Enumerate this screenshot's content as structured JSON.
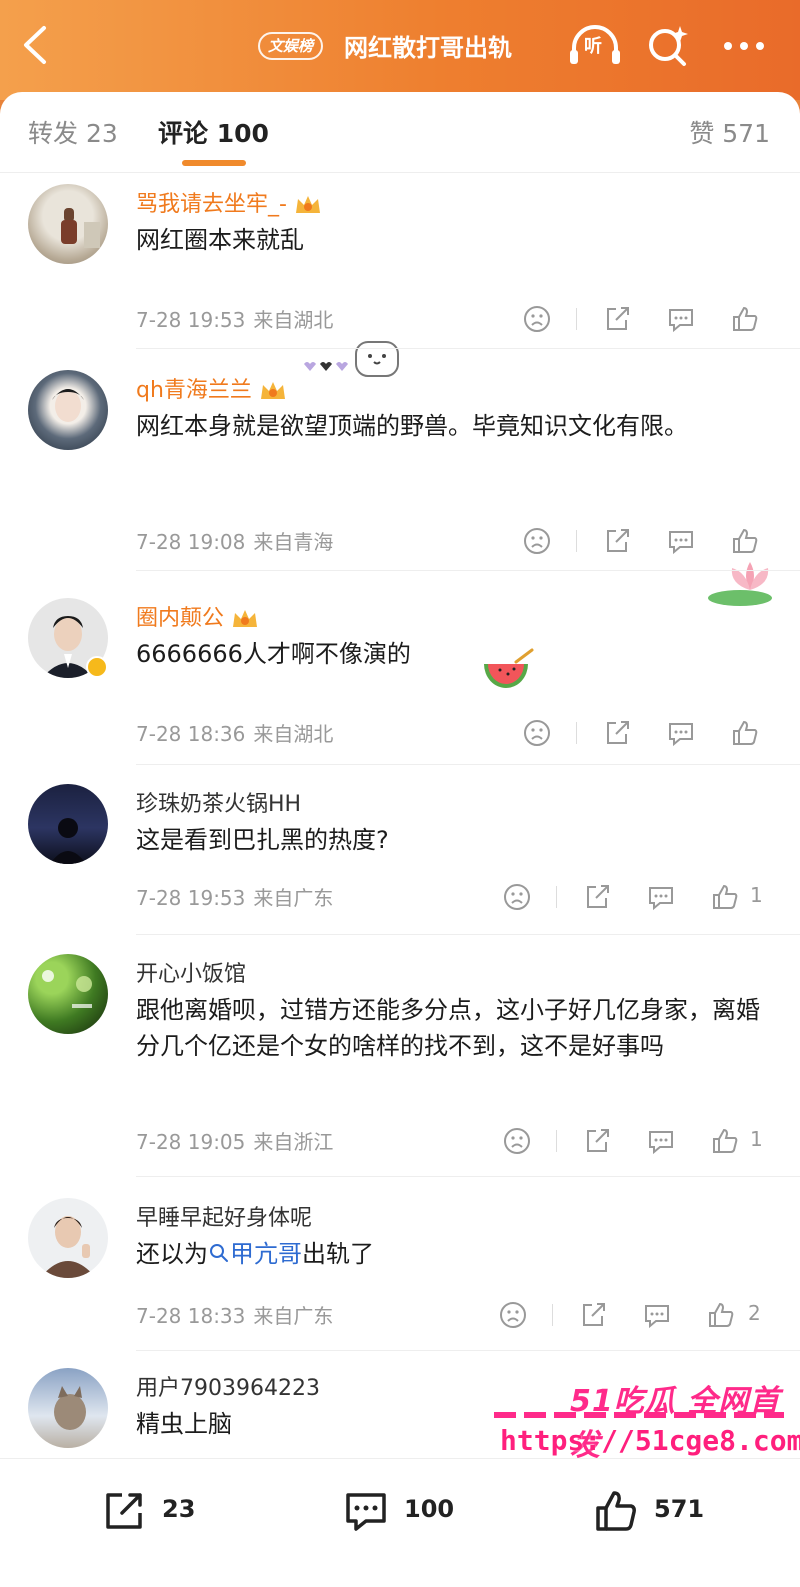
{
  "header": {
    "tag": "文娱榜",
    "title": "网红散打哥出轨",
    "listen_label": "听"
  },
  "tabs": {
    "repost_label": "转发",
    "repost_count": "23",
    "comments_label": "评论",
    "comments_count": "100",
    "likes_label": "赞",
    "likes_count": "571"
  },
  "comments": [
    {
      "username": "骂我请去坐牢_-",
      "text": "网红圈本来就乱",
      "date": "7-28 19:53",
      "region": "来自湖北",
      "likes": ""
    },
    {
      "username": "qh青海兰兰",
      "text": "网红本身就是欲望顶端的野兽。毕竟知识文化有限。",
      "date": "7-28 19:08",
      "region": "来自青海",
      "likes": ""
    },
    {
      "username": "圈内颠公",
      "text": "6666666人才啊不像演的",
      "date": "7-28 18:36",
      "region": "来自湖北",
      "likes": ""
    },
    {
      "username": "珍珠奶茶火锅HH",
      "text": "这是看到巴扎黑的热度?",
      "date": "7-28 19:53",
      "region": "来自广东",
      "likes": "1"
    },
    {
      "username": "开心小饭馆",
      "text": "跟他离婚呗，过错方还能多分点，这小子好几亿身家，离婚分几个亿还是个女的啥样的找不到，这不是好事吗",
      "date": "7-28 19:05",
      "region": "来自浙江",
      "likes": "1"
    },
    {
      "username": "早睡早起好身体呢",
      "text_before": "还以为",
      "topic": "甲亢哥",
      "text_after": "出轨了",
      "date": "7-28 18:33",
      "region": "来自广东",
      "likes": "2"
    },
    {
      "username": "用户7903964223",
      "text": "精虫上脑"
    }
  ],
  "watermark": {
    "brand": "51吃瓜 全网首发",
    "url": "https://51cge8.com"
  },
  "bottom_bar": {
    "repost_count": "23",
    "comment_count": "100",
    "like_count": "571"
  },
  "colors": {
    "header_gradient_start": "#f4a04c",
    "header_gradient_end": "#e96b2a",
    "vip_name": "#f07a1d",
    "topic_link": "#2e6bd1",
    "watermark": "#ff2a8a"
  }
}
